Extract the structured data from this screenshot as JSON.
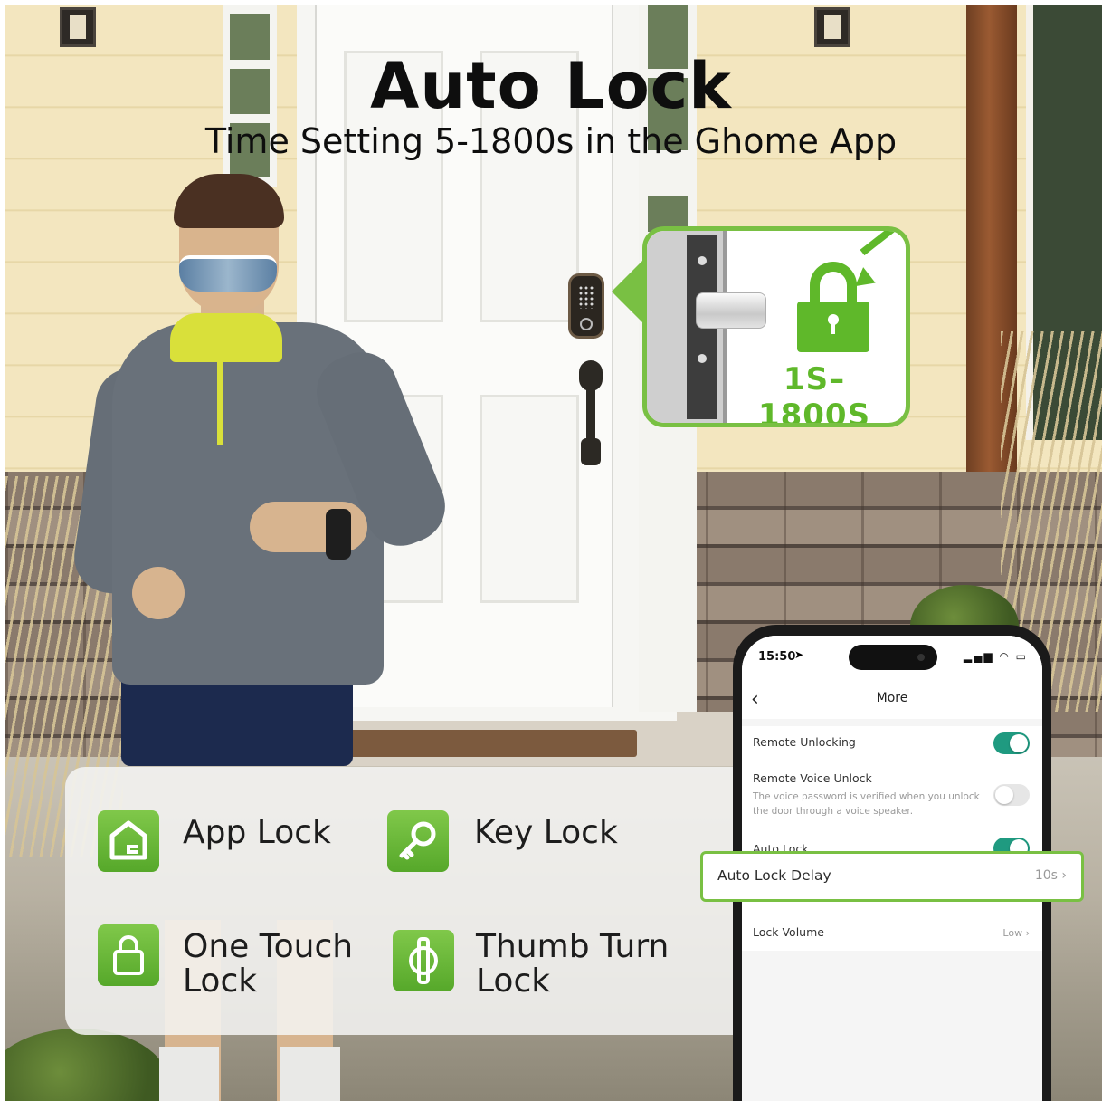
{
  "headline": {
    "title": "Auto Lock",
    "subtitle": "Time Setting 5-1800s in the Ghome App"
  },
  "callout": {
    "range": "1S–1800S",
    "icon": "padlock-icon",
    "accent_color": "#79c043"
  },
  "features": [
    {
      "label": "App Lock",
      "icon": "home-g-icon"
    },
    {
      "label": "Key Lock",
      "icon": "key-icon"
    },
    {
      "label": "One Touch Lock",
      "icon": "padlock-outline-icon"
    },
    {
      "label": "Thumb Turn Lock",
      "icon": "thumb-turn-icon"
    }
  ],
  "phone": {
    "status_time": "15:50",
    "nav_title": "More",
    "rows": {
      "remote_unlocking": {
        "title": "Remote Unlocking",
        "toggle": "on"
      },
      "remote_voice_unlock": {
        "title": "Remote Voice Unlock",
        "description": "The voice password is verified when you unlock the door through a voice speaker.",
        "toggle": "off"
      },
      "auto_lock": {
        "title": "Auto Lock",
        "toggle": "on"
      },
      "auto_lock_delay": {
        "title": "Auto Lock Delay",
        "value": "10s"
      },
      "lock_volume": {
        "title": "Lock Volume",
        "value": "Low"
      }
    },
    "toggle_on_color": "#1f9a80"
  }
}
